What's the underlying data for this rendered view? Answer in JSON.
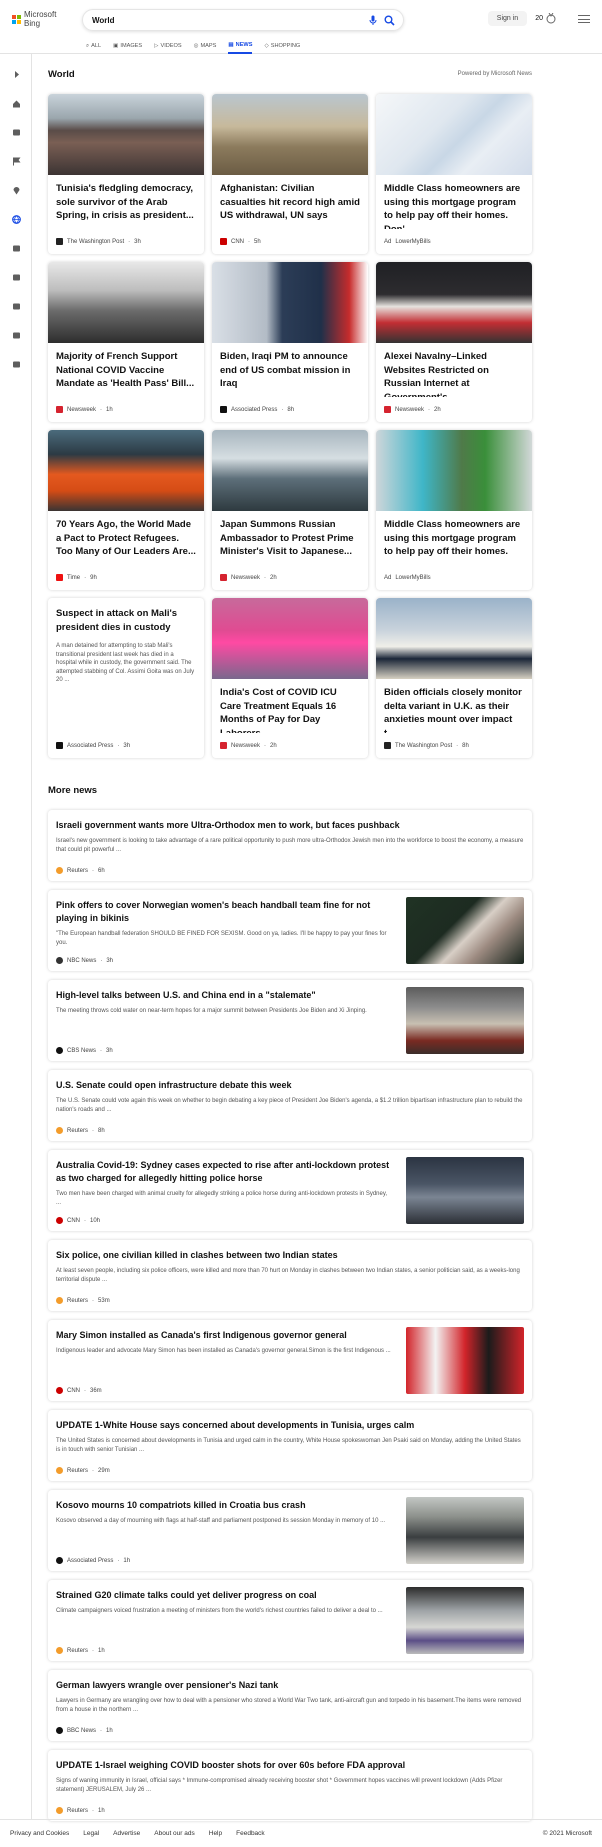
{
  "header": {
    "brand": "Microsoft Bing",
    "search_query": "World",
    "signin_label": "Sign in",
    "rewards_count": "20",
    "brand_colors": [
      "#f25022",
      "#7fba00",
      "#00a4ef",
      "#ffb900"
    ],
    "accent": "#174ae4"
  },
  "tabs": [
    {
      "label": "ALL",
      "icon": "search-icon"
    },
    {
      "label": "IMAGES",
      "icon": "image-icon"
    },
    {
      "label": "VIDEOS",
      "icon": "video-icon"
    },
    {
      "label": "MAPS",
      "icon": "map-icon"
    },
    {
      "label": "NEWS",
      "icon": "news-icon",
      "active": true
    },
    {
      "label": "SHOPPING",
      "icon": "tag-icon"
    }
  ],
  "sidebar_icons": [
    "chevron-right-icon",
    "home-icon",
    "scale-icon",
    "flag-icon",
    "location-pin-icon",
    "globe-icon",
    "microscope-icon",
    "rocket-icon",
    "film-icon",
    "bank-icon",
    "briefcase-icon"
  ],
  "section": {
    "title": "World",
    "powered_by": "Powered by Microsoft News"
  },
  "cards": [
    {
      "title": "Tunisia's fledgling democracy, sole survivor of the Arab Spring, in crisis as president...",
      "provider": "The Washington Post",
      "time": "3h",
      "logo_color": "#222",
      "img": "crowd"
    },
    {
      "title": "Afghanistan: Civilian casualties hit record high amid US withdrawal, UN says",
      "provider": "CNN",
      "time": "5h",
      "logo_color": "#cc0000",
      "img": "soldiers"
    },
    {
      "title": "Middle Class homeowners are using this mortgage program to help pay off their homes. Don'...",
      "provider": "LowerMyBills",
      "time": "",
      "ad": "Ad",
      "logo_color": "#fff",
      "img": "form"
    },
    {
      "title": "Majority of French Support National COVID Vaccine Mandate as 'Health Pass' Bill...",
      "provider": "Newsweek",
      "time": "1h",
      "logo_color": "#d5232f",
      "img": "protest"
    },
    {
      "title": "Biden, Iraqi PM to announce end of US combat mission in Iraq",
      "provider": "Associated Press",
      "time": "8h",
      "logo_color": "#111",
      "img": "suit"
    },
    {
      "title": "Alexei Navalny–Linked Websites Restricted on Russian Internet at Government's...",
      "provider": "Newsweek",
      "time": "2h",
      "logo_color": "#d5232f",
      "img": "sign"
    },
    {
      "title": "70 Years Ago, the World Made a Pact to Protect Refugees. Too Many of Our Leaders Are...",
      "provider": "Time",
      "time": "9h",
      "logo_color": "#e11",
      "img": "lifejackets"
    },
    {
      "title": "Japan Summons Russian Ambassador to Protest Prime Minister's Visit to Japanese...",
      "provider": "Newsweek",
      "time": "2h",
      "logo_color": "#d5232f",
      "img": "station"
    },
    {
      "title": "Middle Class homeowners are using this mortgage program to help pay off their homes.",
      "provider": "LowerMyBills",
      "time": "",
      "ad": "Ad",
      "logo_color": "#fff",
      "img": "glasses"
    },
    {
      "title": "Suspect in attack on Mali's president dies in custody",
      "snippet": "A man detained for attempting to stab Mali's transitional president last week has died in a hospital while in custody, the government said. The attempted stabbing of Col. Assimi Goita was on July 20 ...",
      "provider": "Associated Press",
      "time": "3h",
      "logo_color": "#111",
      "img": ""
    },
    {
      "title": "India's Cost of COVID ICU Care Treatment Equals 16 Months of Pay for Day Laborers",
      "provider": "Newsweek",
      "time": "2h",
      "logo_color": "#d5232f",
      "img": "hospital"
    },
    {
      "title": "Biden officials closely monitor delta variant in U.K. as their anxieties mount over impact t...",
      "provider": "The Washington Post",
      "time": "8h",
      "logo_color": "#222",
      "img": "leaders"
    }
  ],
  "more_news": {
    "title": "More news",
    "items": [
      {
        "title": "Israeli government wants more Ultra-Orthodox men to work, but faces pushback",
        "snippet": "Israel's new government is looking to take advantage of a rare political opportunity to push more ultra-Orthodox Jewish men into the workforce to boost the economy, a measure that could pit powerful ...",
        "provider": "Reuters",
        "time": "6h",
        "logo_color": "#f39c2b",
        "img": "",
        "h": 71
      },
      {
        "title": "Pink offers to cover Norwegian women's beach handball team fine for not playing in bikinis",
        "snippet": "\"The European handball federation SHOULD BE FINED FOR SEXISM. Good on ya, ladies. I'll be happy to pay your fines for you.",
        "provider": "NBC News",
        "time": "3h",
        "logo_color": "#333",
        "img": "pink",
        "h": 81
      },
      {
        "title": "High-level talks between U.S. and China end in a \"stalemate\"",
        "snippet": "The meeting throws cold water on near-term hopes for a major summit between Presidents Joe Biden and Xi Jinping.",
        "provider": "CBS News",
        "time": "3h",
        "logo_color": "#111",
        "img": "meeting",
        "h": 81
      },
      {
        "title": "U.S. Senate could open infrastructure debate this week",
        "snippet": "The U.S. Senate could vote again this week on whether to begin debating a key piece of President Joe Biden's agenda, a $1.2 trillion bipartisan infrastructure plan to rebuild the nation's roads and ...",
        "provider": "Reuters",
        "time": "8h",
        "logo_color": "#f39c2b",
        "img": "",
        "h": 71
      },
      {
        "title": "Australia Covid-19: Sydney cases expected to rise after anti-lockdown protest as two charged for allegedly hitting police horse",
        "snippet": "Two men have been charged with animal cruelty for allegedly striking a police horse during anti-lockdown protests in Sydney, ...",
        "provider": "CNN",
        "time": "10h",
        "logo_color": "#cc0000",
        "img": "crowd2",
        "h": 81
      },
      {
        "title": "Six police, one civilian killed in clashes between two Indian states",
        "snippet": "At least seven people, including six police officers, were killed and more than 70 hurt on Monday in clashes between two Indian states, a senior politician said, as a weeks-long territorial dispute ...",
        "provider": "Reuters",
        "time": "53m",
        "logo_color": "#f39c2b",
        "img": "",
        "h": 71
      },
      {
        "title": "Mary Simon installed as Canada's first Indigenous governor general",
        "snippet": "Indigenous leader and advocate Mary Simon has been installed as Canada's governor general.Simon is the first Indigenous ...",
        "provider": "CNN",
        "time": "36m",
        "logo_color": "#cc0000",
        "img": "canada",
        "h": 81
      },
      {
        "title": "UPDATE 1-White House says concerned about developments in Tunisia, urges calm",
        "snippet": "The United States is concerned about developments in Tunisia and urged calm in the country, White House spokeswoman Jen Psaki said on Monday, adding the United States is in touch with senior Tunisian ...",
        "provider": "Reuters",
        "time": "29m",
        "logo_color": "#f39c2b",
        "img": "",
        "h": 71
      },
      {
        "title": "Kosovo mourns 10 compatriots killed in Croatia bus crash",
        "snippet": "Kosovo observed a day of mourning with flags at half-staff and parliament postponed its session Monday in memory of 10 ...",
        "provider": "Associated Press",
        "time": "1h",
        "logo_color": "#111",
        "img": "funeral",
        "h": 81
      },
      {
        "title": "Strained G20 climate talks could yet deliver progress on coal",
        "snippet": "Climate campaigners voiced frustration a meeting of ministers from the world's richest countries failed to deliver a deal to ...",
        "provider": "Reuters",
        "time": "1h",
        "logo_color": "#f39c2b",
        "img": "g20",
        "h": 81
      },
      {
        "title": "German lawyers wrangle over pensioner's Nazi tank",
        "snippet": "Lawyers in Germany are wrangling over how to deal with a pensioner who stored a World War Two tank, anti-aircraft gun and torpedo in his basement.The items were removed from a house in the northern ...",
        "provider": "BBC News",
        "time": "1h",
        "logo_color": "#111",
        "img": "",
        "h": 71
      },
      {
        "title": "UPDATE 1-Israel weighing COVID booster shots for over 60s before FDA approval",
        "snippet": "Signs of waning immunity in Israel, official says * Immune-compromised already receiving booster shot * Government hopes vaccines will prevent lockdown (Adds Pfizer statement) JERUSALEM, July 26 ...",
        "provider": "Reuters",
        "time": "1h",
        "logo_color": "#f39c2b",
        "img": "",
        "h": 71
      }
    ]
  },
  "footer": {
    "links": [
      "Privacy and Cookies",
      "Legal",
      "Advertise",
      "About our ads",
      "Help",
      "Feedback"
    ],
    "copyright": "© 2021 Microsoft"
  }
}
